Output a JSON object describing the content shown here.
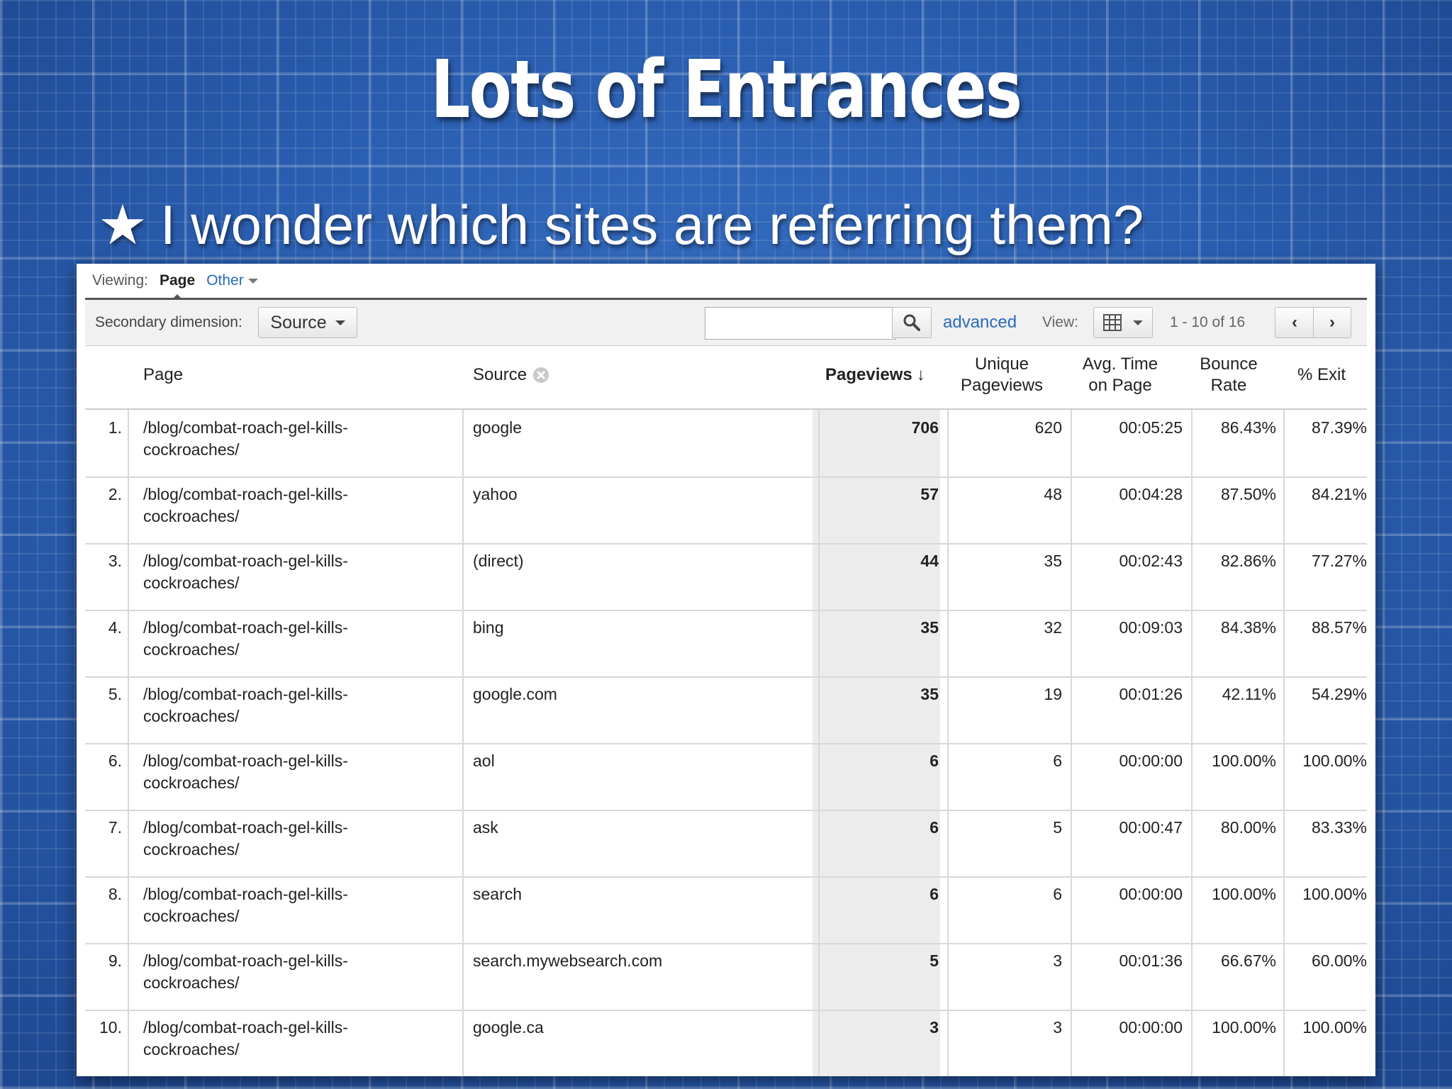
{
  "slide": {
    "title": "Lots of Entrances",
    "bullet": "I wonder which sites are referring them?",
    "bullet_icon": "star-icon"
  },
  "viewing": {
    "label": "Viewing:",
    "active": "Page",
    "other": "Other"
  },
  "toolbar": {
    "secondary_label": "Secondary dimension:",
    "secondary_value": "Source",
    "search_placeholder": "",
    "advanced": "advanced",
    "view_label": "View:",
    "pagination": "1 - 10 of 16",
    "prev": "‹",
    "next": "›"
  },
  "table": {
    "headers": {
      "page": "Page",
      "source": "Source",
      "pageviews": "Pageviews",
      "unique_1": "Unique",
      "unique_2": "Pageviews",
      "avg_1": "Avg. Time",
      "avg_2": "on Page",
      "bounce_1": "Bounce",
      "bounce_2": "Rate",
      "exit": "% Exit"
    },
    "rows": [
      {
        "n": "1.",
        "p1": "/blog/combat-roach-gel-kills-",
        "p2": "cockroaches/",
        "src": "google",
        "pv": "706",
        "upv": "620",
        "avg": "00:05:25",
        "br": "86.43%",
        "ex": "87.39%"
      },
      {
        "n": "2.",
        "p1": "/blog/combat-roach-gel-kills-",
        "p2": "cockroaches/",
        "src": "yahoo",
        "pv": "57",
        "upv": "48",
        "avg": "00:04:28",
        "br": "87.50%",
        "ex": "84.21%"
      },
      {
        "n": "3.",
        "p1": "/blog/combat-roach-gel-kills-",
        "p2": "cockroaches/",
        "src": "(direct)",
        "pv": "44",
        "upv": "35",
        "avg": "00:02:43",
        "br": "82.86%",
        "ex": "77.27%"
      },
      {
        "n": "4.",
        "p1": "/blog/combat-roach-gel-kills-",
        "p2": "cockroaches/",
        "src": "bing",
        "pv": "35",
        "upv": "32",
        "avg": "00:09:03",
        "br": "84.38%",
        "ex": "88.57%"
      },
      {
        "n": "5.",
        "p1": "/blog/combat-roach-gel-kills-",
        "p2": "cockroaches/",
        "src": "google.com",
        "pv": "35",
        "upv": "19",
        "avg": "00:01:26",
        "br": "42.11%",
        "ex": "54.29%"
      },
      {
        "n": "6.",
        "p1": "/blog/combat-roach-gel-kills-",
        "p2": "cockroaches/",
        "src": "aol",
        "pv": "6",
        "upv": "6",
        "avg": "00:00:00",
        "br": "100.00%",
        "ex": "100.00%"
      },
      {
        "n": "7.",
        "p1": "/blog/combat-roach-gel-kills-",
        "p2": "cockroaches/",
        "src": "ask",
        "pv": "6",
        "upv": "5",
        "avg": "00:00:47",
        "br": "80.00%",
        "ex": "83.33%"
      },
      {
        "n": "8.",
        "p1": "/blog/combat-roach-gel-kills-",
        "p2": "cockroaches/",
        "src": "search",
        "pv": "6",
        "upv": "6",
        "avg": "00:00:00",
        "br": "100.00%",
        "ex": "100.00%"
      },
      {
        "n": "9.",
        "p1": "/blog/combat-roach-gel-kills-",
        "p2": "cockroaches/",
        "src": "search.mywebsearch.com",
        "pv": "5",
        "upv": "3",
        "avg": "00:01:36",
        "br": "66.67%",
        "ex": "60.00%"
      },
      {
        "n": "10.",
        "p1": "/blog/combat-roach-gel-kills-",
        "p2": "cockroaches/",
        "src": "google.ca",
        "pv": "3",
        "upv": "3",
        "avg": "00:00:00",
        "br": "100.00%",
        "ex": "100.00%"
      }
    ]
  }
}
